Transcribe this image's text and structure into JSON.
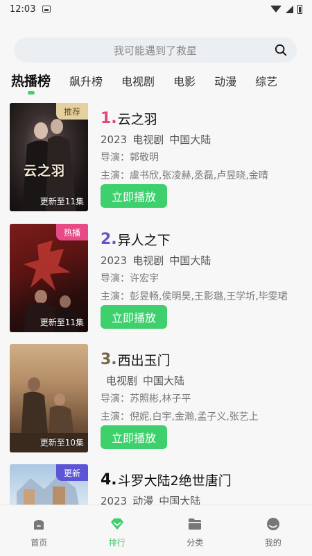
{
  "status_bar": {
    "time": "12:03"
  },
  "search": {
    "placeholder": "我可能遇到了救星"
  },
  "tabs": [
    {
      "label": "热播榜",
      "active": true
    },
    {
      "label": "飙升榜"
    },
    {
      "label": "电视剧"
    },
    {
      "label": "电影"
    },
    {
      "label": "动漫"
    },
    {
      "label": "综艺"
    }
  ],
  "items": [
    {
      "rank": "1.",
      "title": "云之羽",
      "rank_color": "#e1457d",
      "year": "2023",
      "category": "电视剧",
      "region": "中国大陆",
      "director": "导演：郭敬明",
      "cast": "主演：虞书欣,张凌赫,丞磊,卢昱晓,金晴",
      "badge": "推荐",
      "badge_color": "#e5d09f",
      "update": "更新至11集",
      "poster_text": "云之羽",
      "play_label": "立即播放"
    },
    {
      "rank": "2.",
      "title": "异人之下",
      "rank_color": "#6455c9",
      "year": "2023",
      "category": "电视剧",
      "region": "中国大陆",
      "director": "导演：许宏宇",
      "cast": "主演：彭昱畅,侯明昊,王影璐,王学圻,毕雯珺",
      "badge": "热播",
      "badge_color": "#e74a86",
      "update": "更新至11集",
      "play_label": "立即播放"
    },
    {
      "rank": "3.",
      "title": "西出玉门",
      "rank_color": "#7a6448",
      "year": "",
      "category": "电视剧",
      "region": "中国大陆",
      "director": "导演：苏照彬,林子平",
      "cast": "主演：倪妮,白宇,金瀚,孟子义,张艺上",
      "update": "更新至10集",
      "play_label": "立即播放"
    },
    {
      "rank": "4.",
      "title": "斗罗大陆2绝世唐门",
      "rank_color": "#111111",
      "year": "2023",
      "category": "动漫",
      "region": "中国大陆",
      "badge": "更新",
      "badge_color": "#5c55d6"
    }
  ],
  "bottom_nav": [
    {
      "label": "首页",
      "icon": "home-icon"
    },
    {
      "label": "排行",
      "icon": "ranking-icon",
      "active": true
    },
    {
      "label": "分类",
      "icon": "folder-icon"
    },
    {
      "label": "我的",
      "icon": "profile-icon"
    }
  ],
  "accent_color": "#3dd06c"
}
